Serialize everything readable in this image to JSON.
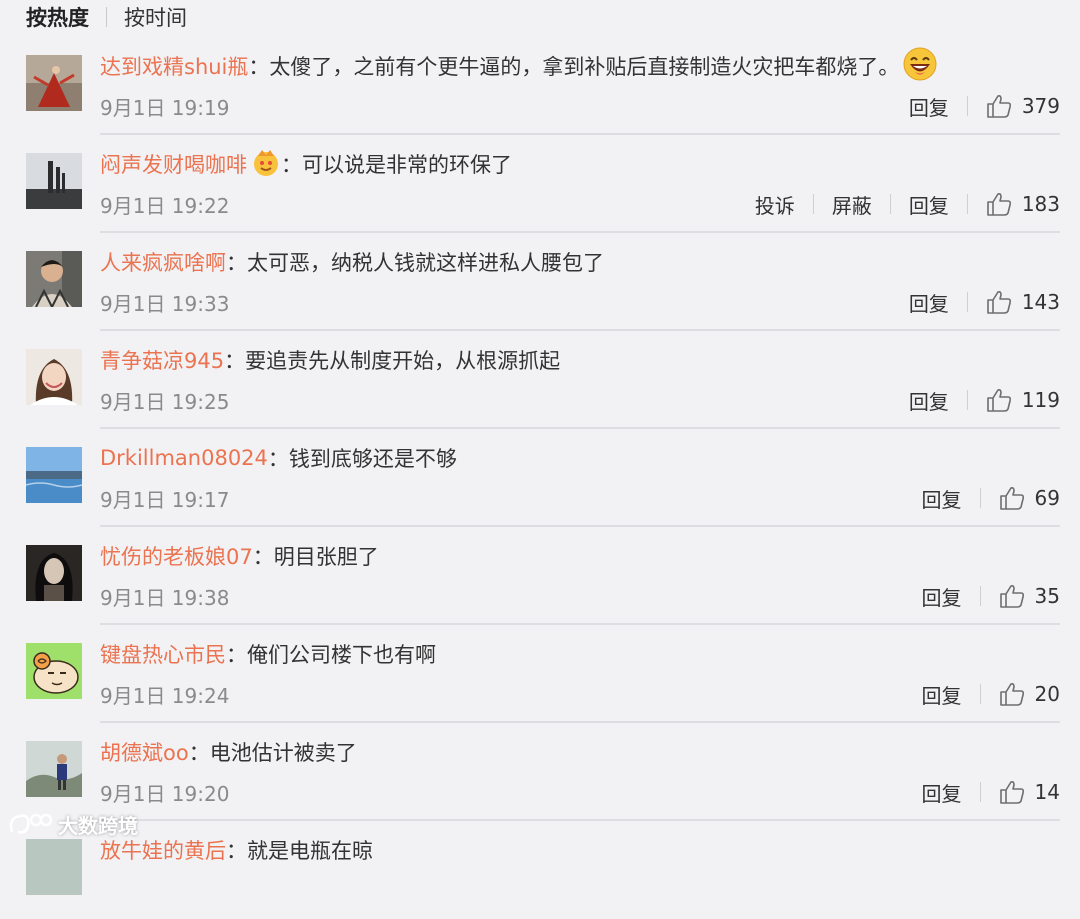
{
  "sort_tabs": {
    "hot": "按热度",
    "time": "按时间"
  },
  "comments": [
    {
      "username": "达到戏精shui瓶",
      "text": "太傻了，之前有个更牛逼的，拿到补贴后直接制造火灾把车都烧了。",
      "emoji": "laughing-emoji",
      "time": "9月1日 19:19",
      "reply": "回复",
      "likes": "379"
    },
    {
      "username": "闷声发财喝咖啡",
      "text": "可以说是非常的环保了",
      "emoji": "vip-crown-badge",
      "time": "9月1日 19:22",
      "report": "投诉",
      "block": "屏蔽",
      "reply": "回复",
      "likes": "183"
    },
    {
      "username": "人来疯疯啥啊",
      "text": "太可恶，纳税人钱就这样进私人腰包了",
      "time": "9月1日 19:33",
      "reply": "回复",
      "likes": "143"
    },
    {
      "username": "青争菇凉945",
      "text": "要追责先从制度开始，从根源抓起",
      "time": "9月1日 19:25",
      "reply": "回复",
      "likes": "119"
    },
    {
      "username": "Drkillman08024",
      "text": "钱到底够还是不够",
      "time": "9月1日 19:17",
      "reply": "回复",
      "likes": "69"
    },
    {
      "username": "忧伤的老板娘07",
      "text": "明目张胆了",
      "time": "9月1日 19:38",
      "reply": "回复",
      "likes": "35"
    },
    {
      "username": "键盘热心市民",
      "text": "俺们公司楼下也有啊",
      "time": "9月1日 19:24",
      "reply": "回复",
      "likes": "20"
    },
    {
      "username": "胡德斌oo",
      "text": "电池估计被卖了",
      "time": "9月1日 19:20",
      "reply": "回复",
      "likes": "14"
    }
  ],
  "partial_comment": {
    "username": "放牛娃的黄后",
    "text": "就是电瓶在晾"
  },
  "watermark": {
    "text": "大数跨境"
  },
  "colors": {
    "background": "#f2f2f5",
    "username": "#eb7350",
    "text": "#333333",
    "meta": "#8a8a8a",
    "divider": "#dedee2"
  }
}
